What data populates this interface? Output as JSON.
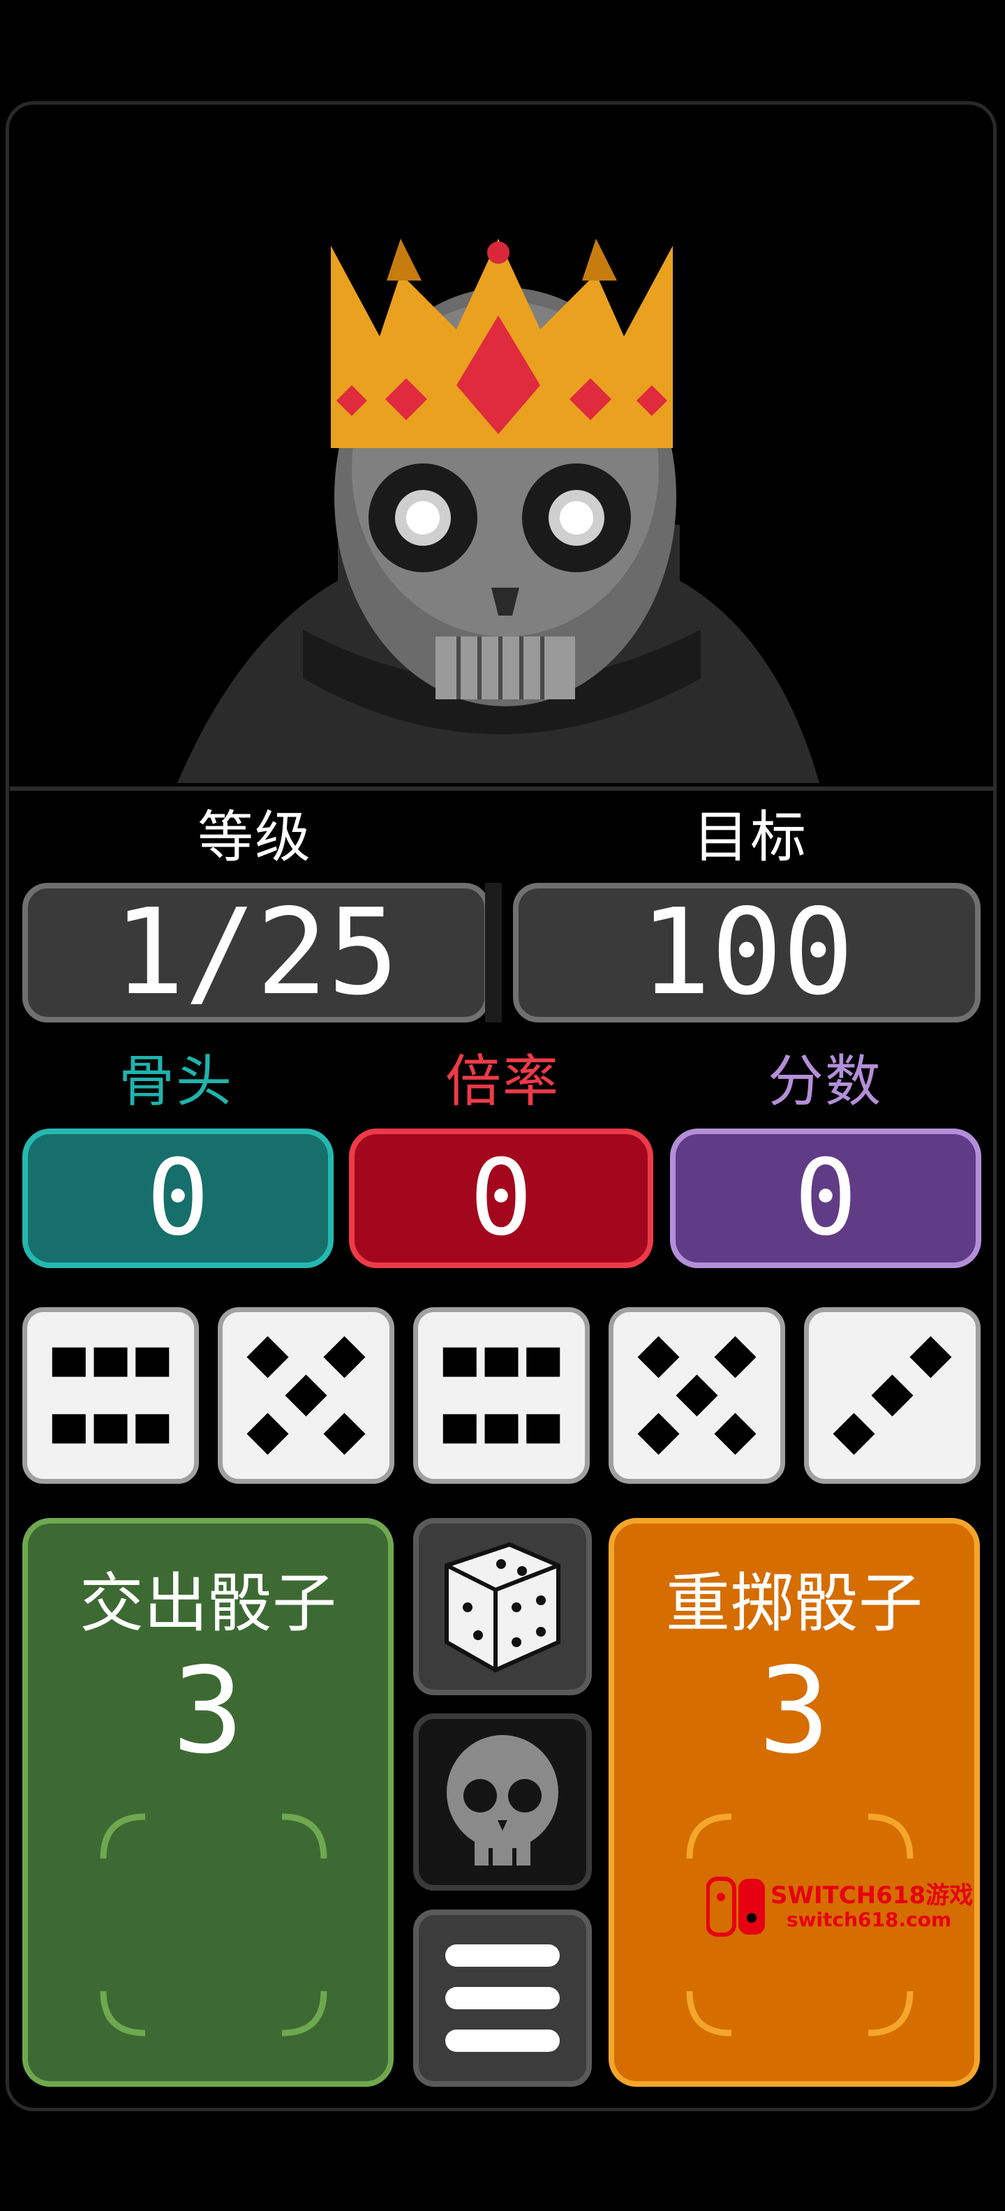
{
  "stats": {
    "level_label": "等级",
    "level_value": "1/25",
    "target_label": "目标",
    "target_value": "100"
  },
  "counters": [
    {
      "label": "骨头",
      "value": "0",
      "color": "#1f8a84"
    },
    {
      "label": "倍率",
      "value": "0",
      "color": "#c0182a"
    },
    {
      "label": "分数",
      "value": "0",
      "color": "#9c6fc2"
    }
  ],
  "dice": [
    6,
    5,
    6,
    5,
    3
  ],
  "panels": {
    "left": {
      "title": "交出骰子",
      "count": "3",
      "color": "#3e6b35"
    },
    "right": {
      "title": "重掷骰子",
      "count": "3",
      "color": "#d56d00"
    }
  },
  "buttons": [
    "dice-icon",
    "skull-icon",
    "menu-icon"
  ],
  "watermark": {
    "line1": "SWITCH618游戏",
    "line2": "switch618.com"
  }
}
